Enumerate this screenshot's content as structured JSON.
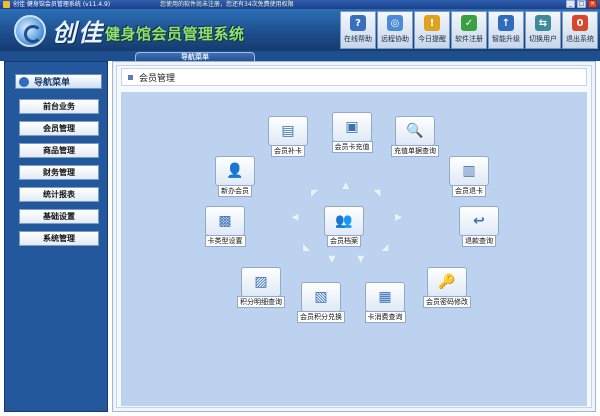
{
  "window": {
    "title": "创佳 健身馆会员管理系统 (v11.4.9)",
    "notice": "您使用的软件尚未注册，您还有34次免费使用权限"
  },
  "header": {
    "logo_script": "创佳",
    "app_title": "健身馆会员管理系统"
  },
  "toolbar": [
    {
      "label": "在线帮助",
      "icon": "help-icon",
      "color": "#3a6fc0",
      "glyph": "?"
    },
    {
      "label": "远程协助",
      "icon": "remote-icon",
      "color": "#4b8ad6",
      "glyph": "◎"
    },
    {
      "label": "今日提醒",
      "icon": "reminder-icon",
      "color": "#e0a020",
      "glyph": "!"
    },
    {
      "label": "软件注册",
      "icon": "register-icon",
      "color": "#3aa040",
      "glyph": "✓"
    },
    {
      "label": "智能升级",
      "icon": "upgrade-icon",
      "color": "#2f6cc0",
      "glyph": "↑"
    },
    {
      "label": "切换用户",
      "icon": "switch-user-icon",
      "color": "#3c8a9a",
      "glyph": "⇆"
    },
    {
      "label": "退出系统",
      "icon": "exit-icon",
      "color": "#d8462c",
      "glyph": "0"
    }
  ],
  "nav_tab": "导航菜单",
  "sidebar": {
    "heading": "导航菜单",
    "items": [
      {
        "label": "前台业务"
      },
      {
        "label": "会员管理"
      },
      {
        "label": "商品管理"
      },
      {
        "label": "财务管理"
      },
      {
        "label": "统计报表"
      },
      {
        "label": "基础设置"
      },
      {
        "label": "系统管理"
      }
    ]
  },
  "main": {
    "title": "会员管理",
    "center": {
      "label": "会员档案",
      "icon": "member-profile-icon"
    },
    "nodes": [
      {
        "label": "会员补卡",
        "icon": "card-reissue-icon"
      },
      {
        "label": "会员卡充值",
        "icon": "card-recharge-icon"
      },
      {
        "label": "充值单据查询",
        "icon": "recharge-query-icon"
      },
      {
        "label": "会员退卡",
        "icon": "card-return-icon"
      },
      {
        "label": "退款查询",
        "icon": "refund-query-icon"
      },
      {
        "label": "会员密码修改",
        "icon": "password-change-icon"
      },
      {
        "label": "卡消费查询",
        "icon": "card-consume-query-icon"
      },
      {
        "label": "会员积分兑换",
        "icon": "points-exchange-icon"
      },
      {
        "label": "积分明细查询",
        "icon": "points-detail-icon"
      },
      {
        "label": "卡类型设置",
        "icon": "card-type-icon"
      },
      {
        "label": "新办会员",
        "icon": "new-member-icon"
      }
    ]
  }
}
